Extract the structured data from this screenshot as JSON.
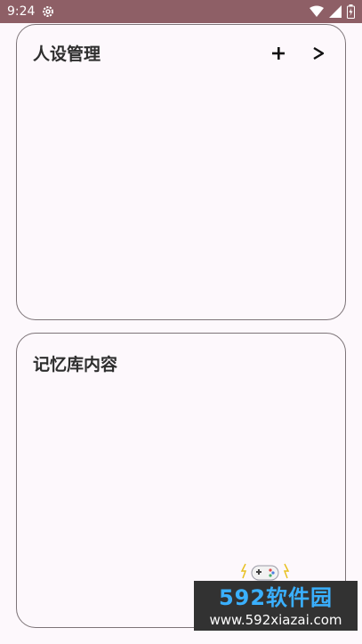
{
  "status_bar": {
    "time": "9:24",
    "icons": [
      "gear-icon",
      "wifi-icon",
      "signal-icon",
      "battery-icon"
    ]
  },
  "personas_card": {
    "title": "人设管理",
    "add_label": "+",
    "next_label": ">"
  },
  "memory_card": {
    "title": "记忆库内容"
  },
  "watermark": {
    "brand": "592软件园",
    "url": "www.592xiazai.com"
  },
  "colors": {
    "status_bar": "#8e5f66",
    "background": "#fdf8fc",
    "card_border": "#7d7478",
    "watermark_brand": "#3ab0ff",
    "watermark_bg": "#323232"
  }
}
